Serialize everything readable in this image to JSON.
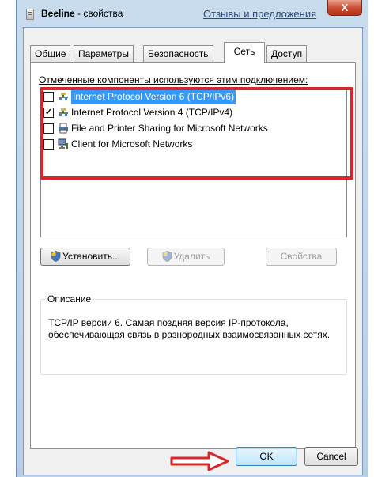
{
  "window": {
    "title_bold": "Beeline",
    "title_rest": " - свойства",
    "feedback_link": "Отзывы и предложения",
    "close_label": "X"
  },
  "tabs": [
    {
      "label": "Общие"
    },
    {
      "label": "Параметры"
    },
    {
      "label": "Безопасность"
    },
    {
      "label": "Сеть",
      "active": true
    },
    {
      "label": "Доступ"
    }
  ],
  "network": {
    "components_label": "Отмеченные компоненты используются этим подключением:",
    "components": [
      {
        "label": "Internet Protocol Version 6 (TCP/IPv6)",
        "checked": false,
        "selected": true,
        "icon": "network-protocol-icon"
      },
      {
        "label": "Internet Protocol Version 4 (TCP/IPv4)",
        "checked": true,
        "selected": false,
        "icon": "network-protocol-icon"
      },
      {
        "label": "File and Printer Sharing for Microsoft Networks",
        "checked": false,
        "selected": false,
        "icon": "printer-sharing-icon"
      },
      {
        "label": "Client for Microsoft Networks",
        "checked": false,
        "selected": false,
        "icon": "network-client-icon"
      }
    ],
    "install_button": "Установить...",
    "uninstall_button": "Удалить",
    "properties_button": "Свойства",
    "description_title": "Описание",
    "description_text": "TCP/IP версии 6. Самая поздняя версия IP-протокола, обеспечивающая связь в разнородных взаимосвязанных сетях."
  },
  "footer": {
    "ok_button": "OK",
    "cancel_button": "Cancel"
  },
  "colors": {
    "highlight": "#d9262b",
    "selection": "#3399ff"
  }
}
